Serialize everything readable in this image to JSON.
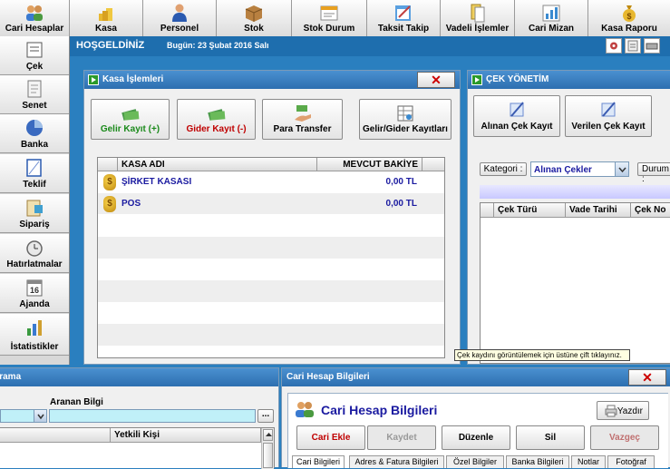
{
  "topbar": {
    "items": [
      {
        "label": "Cari Hesaplar"
      },
      {
        "label": "Kasa"
      },
      {
        "label": "Personel"
      },
      {
        "label": "Stok"
      },
      {
        "label": "Stok Durum"
      },
      {
        "label": "Taksit Takip"
      },
      {
        "label": "Vadeli İşlemler"
      },
      {
        "label": "Cari Mizan"
      },
      {
        "label": "Kasa Raporu"
      }
    ]
  },
  "sidebar": {
    "items": [
      {
        "label": "Çek"
      },
      {
        "label": "Senet"
      },
      {
        "label": "Banka"
      },
      {
        "label": "Teklif"
      },
      {
        "label": "Sipariş"
      },
      {
        "label": "Hatırlatmalar"
      },
      {
        "label": "Ajanda"
      },
      {
        "label": "İstatistikler"
      }
    ]
  },
  "welcome": {
    "greeting": "HOŞGELDİNİZ",
    "date": "Bugün: 23 Şubat 2016 Salı"
  },
  "kasa": {
    "title": "Kasa İşlemleri",
    "close": "✕",
    "buttons": {
      "gelir": "Gelir Kayıt (+)",
      "gider": "Gider Kayıt (-)",
      "transfer": "Para Transfer",
      "kayitlar": "Gelir/Gider Kayıtları"
    },
    "columns": {
      "name": "KASA ADI",
      "balance": "MEVCUT BAKİYE"
    },
    "rows": [
      {
        "name": "ŞİRKET KASASI",
        "balance": "0,00 TL"
      },
      {
        "name": "POS",
        "balance": "0,00 TL"
      }
    ]
  },
  "cek": {
    "title": "ÇEK YÖNETİM",
    "alinan": "Alınan Çek Kayıt",
    "verilen": "Verilen Çek Kayıt",
    "kategori_label": "Kategori :",
    "kategori_value": "Alınan Çekler",
    "durum_label": "Durum :",
    "columns": {
      "tur": "Çek Türü",
      "vade": "Vade Tarihi",
      "no": "Çek No"
    },
    "tooltip": "Çek kaydını görüntülemek için üstüne çift tıklayınız."
  },
  "arama": {
    "title": "Arama",
    "aranan_label": "Aranan Bilgi",
    "browse": "...",
    "col_yetkili": "Yetkili Kişi"
  },
  "cari": {
    "panel_title": "Cari Hesap Bilgileri",
    "close": "✕",
    "heading": "Cari Hesap Bilgileri",
    "print": "Yazdır",
    "buttons": {
      "ekle": "Cari Ekle",
      "kaydet": "Kaydet",
      "duzenle": "Düzenle",
      "sil": "Sil",
      "vazgec": "Vazgeç"
    },
    "tabs": [
      "Cari Bilgileri",
      "Adres & Fatura Bilgileri",
      "Özel Bilgiler",
      "Banka Bilgileri",
      "Notlar",
      "Fotoğraf"
    ]
  },
  "colors": {
    "accent": "#2d6fb0",
    "red_text": "#c00000",
    "green_text": "#1a8a1a",
    "blue_text": "#1a1aa0"
  }
}
